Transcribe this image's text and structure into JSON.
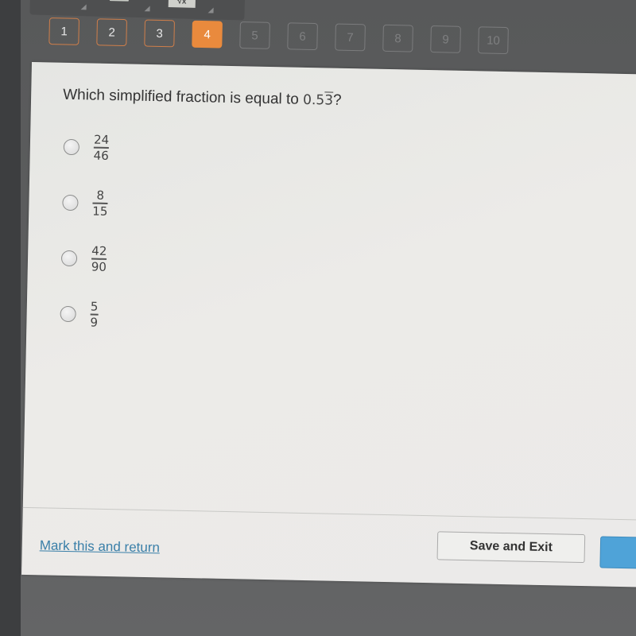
{
  "toolbar": {
    "tools": [
      {
        "icon": "tool-icon"
      },
      {
        "icon": "tool-icon"
      },
      {
        "icon": "sqrt-icon",
        "glyph": "√x"
      }
    ]
  },
  "navigator": {
    "current": 4,
    "questions": [
      {
        "label": "1",
        "state": "answered"
      },
      {
        "label": "2",
        "state": "answered"
      },
      {
        "label": "3",
        "state": "answered"
      },
      {
        "label": "4",
        "state": "current"
      },
      {
        "label": "5",
        "state": "disabled"
      },
      {
        "label": "6",
        "state": "disabled"
      },
      {
        "label": "7",
        "state": "disabled"
      },
      {
        "label": "8",
        "state": "disabled"
      },
      {
        "label": "9",
        "state": "disabled"
      },
      {
        "label": "10",
        "state": "disabled"
      }
    ]
  },
  "question": {
    "text": "Which simplified fraction is equal to ",
    "decimal_prefix": "0.5",
    "decimal_repeating": "3",
    "suffix": "?"
  },
  "options": [
    {
      "numerator": "24",
      "denominator": "46",
      "selected": false
    },
    {
      "numerator": "8",
      "denominator": "15",
      "selected": false
    },
    {
      "numerator": "42",
      "denominator": "90",
      "selected": false
    },
    {
      "numerator": "5",
      "denominator": "9",
      "selected": false
    }
  ],
  "footer": {
    "mark_link": "Mark this and return",
    "save_exit": "Save and Exit",
    "next_label": ""
  },
  "colors": {
    "accent_orange": "#e98a3d",
    "link_blue": "#3a7fa8",
    "primary_button": "#4fa3d8"
  }
}
